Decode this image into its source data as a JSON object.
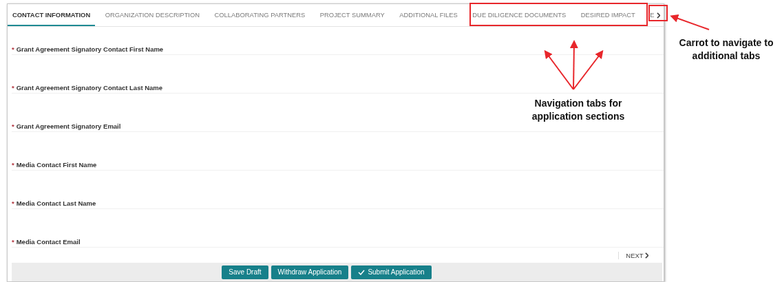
{
  "tabs": [
    {
      "label": "CONTACT INFORMATION",
      "selected": true
    },
    {
      "label": "ORGANIZATION DESCRIPTION",
      "selected": false
    },
    {
      "label": "COLLABORATING PARTNERS",
      "selected": false
    },
    {
      "label": "PROJECT SUMMARY",
      "selected": false
    },
    {
      "label": "ADDITIONAL FILES",
      "selected": false
    },
    {
      "label": "DUE DILIGENCE DOCUMENTS",
      "selected": false
    },
    {
      "label": "DESIRED IMPACT",
      "selected": false
    },
    {
      "label": "E",
      "selected": false
    }
  ],
  "fields": [
    {
      "label": "Grant Agreement Signatory Contact First Name",
      "required_mark": "*"
    },
    {
      "label": "Grant Agreement Signatory Contact Last Name",
      "required_mark": "*"
    },
    {
      "label": "Grant Agreement Signatory Email",
      "required_mark": "*"
    },
    {
      "label": "Media Contact First Name",
      "required_mark": "*"
    },
    {
      "label": "Media Contact Last Name",
      "required_mark": "*"
    },
    {
      "label": "Media Contact Email",
      "required_mark": "*"
    }
  ],
  "next_button": "NEXT",
  "actions": [
    {
      "label": "Save Draft",
      "kind": "plain"
    },
    {
      "label": "Withdraw Application",
      "kind": "plain"
    },
    {
      "label": "Submit Application",
      "kind": "check"
    }
  ],
  "annotations": [
    {
      "kind": "carrot",
      "text": "Carrot to navigate to additional tabs"
    },
    {
      "kind": "tabs",
      "text": "Navigation tabs for application sections"
    }
  ]
}
